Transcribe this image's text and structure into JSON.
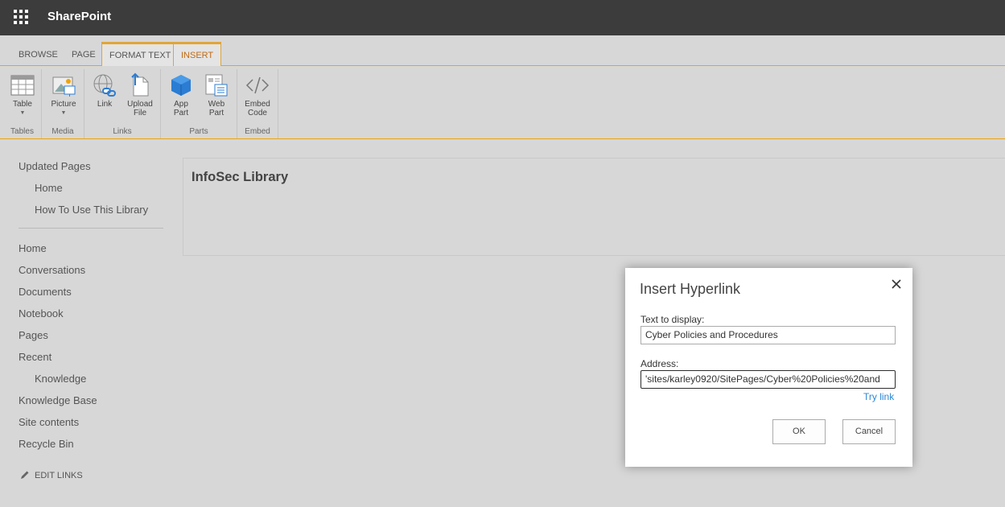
{
  "suitebar": {
    "brand": "SharePoint",
    "app_launcher_icon": "waffle-icon"
  },
  "ribbon": {
    "tabs": [
      {
        "label": "BROWSE",
        "active": false
      },
      {
        "label": "PAGE",
        "active": false
      },
      {
        "label": "FORMAT TEXT",
        "active": false
      },
      {
        "label": "INSERT",
        "active": true
      }
    ],
    "groups": [
      {
        "label": "Tables",
        "buttons": [
          {
            "label": "Table",
            "icon": "table-icon"
          }
        ]
      },
      {
        "label": "Media",
        "buttons": [
          {
            "label": "Picture",
            "icon": "picture-icon"
          }
        ]
      },
      {
        "label": "Links",
        "buttons": [
          {
            "label": "Link",
            "icon": "link-icon"
          },
          {
            "label": "Upload",
            "label2": "File",
            "icon": "upload-file-icon"
          }
        ]
      },
      {
        "label": "Parts",
        "buttons": [
          {
            "label": "App",
            "label2": "Part",
            "icon": "app-part-icon"
          },
          {
            "label": "Web",
            "label2": "Part",
            "icon": "web-part-icon"
          }
        ]
      },
      {
        "label": "Embed",
        "buttons": [
          {
            "label": "Embed",
            "label2": "Code",
            "icon": "embed-code-icon"
          }
        ]
      }
    ],
    "accent": "#f0a30a"
  },
  "nav": {
    "updated_pages": "Updated Pages",
    "updated_items": [
      "Home",
      "How To Use This Library"
    ],
    "items": [
      {
        "label": "Home",
        "sub": false
      },
      {
        "label": "Conversations",
        "sub": false
      },
      {
        "label": "Documents",
        "sub": false
      },
      {
        "label": "Notebook",
        "sub": false
      },
      {
        "label": "Pages",
        "sub": false
      },
      {
        "label": "Recent",
        "sub": false
      },
      {
        "label": "Knowledge",
        "sub": true
      },
      {
        "label": "Knowledge Base",
        "sub": false
      },
      {
        "label": "Site contents",
        "sub": false
      },
      {
        "label": "Recycle Bin",
        "sub": false
      }
    ],
    "edit_links": "EDIT LINKS"
  },
  "content": {
    "title": "InfoSec Library"
  },
  "dialog": {
    "title": "Insert Hyperlink",
    "text_label": "Text to display:",
    "text_value": "Cyber Policies and Procedures",
    "address_label": "Address:",
    "address_value": "'sites/karley0920/SitePages/Cyber%20Policies%20and",
    "try_link": "Try link",
    "ok": "OK",
    "cancel": "Cancel"
  }
}
